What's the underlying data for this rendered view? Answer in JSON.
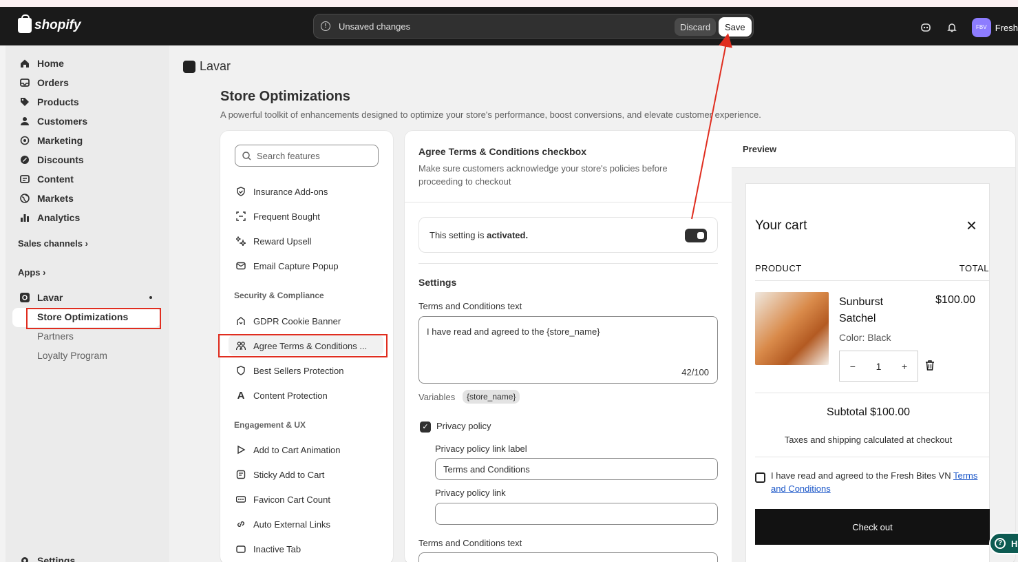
{
  "topbar": {
    "brand": "shopify",
    "unsaved_message": "Unsaved changes",
    "discard_label": "Discard",
    "save_label": "Save",
    "avatar_initials": "FBV",
    "avatar_name": "Fresh"
  },
  "sidebar": {
    "items": [
      {
        "label": "Home",
        "icon": "home-icon"
      },
      {
        "label": "Orders",
        "icon": "inbox-icon"
      },
      {
        "label": "Products",
        "icon": "tag-icon"
      },
      {
        "label": "Customers",
        "icon": "person-icon"
      },
      {
        "label": "Marketing",
        "icon": "target-icon"
      },
      {
        "label": "Discounts",
        "icon": "discount-icon"
      },
      {
        "label": "Content",
        "icon": "content-icon"
      },
      {
        "label": "Markets",
        "icon": "globe-icon"
      },
      {
        "label": "Analytics",
        "icon": "bar-chart-icon"
      }
    ],
    "sales_channels": "Sales channels",
    "apps": "Apps",
    "app_name": "Lavar",
    "app_sub": [
      "Store Optimizations",
      "Partners",
      "Loyalty Program"
    ],
    "settings": "Settings"
  },
  "main": {
    "app_title": "Lavar",
    "page_title": "Store Optimizations",
    "page_subtitle": "A powerful toolkit of enhancements designed to optimize your store's performance, boost conversions, and elevate customer experience."
  },
  "features": {
    "search_placeholder": "Search features",
    "group1": [
      "Insurance Add-ons",
      "Frequent Bought",
      "Reward Upsell",
      "Email Capture Popup"
    ],
    "group2_title": "Security & Compliance",
    "group2": [
      "GDPR Cookie Banner",
      "Agree Terms & Conditions ...",
      "Best Sellers Protection",
      "Content Protection"
    ],
    "group3_title": "Engagement & UX",
    "group3": [
      "Add to Cart Animation",
      "Sticky Add to Cart",
      "Favicon Cart Count",
      "Auto External Links",
      "Inactive Tab"
    ]
  },
  "settings": {
    "title": "Agree Terms & Conditions checkbox",
    "description": "Make sure customers acknowledge your store's policies before proceeding to checkout",
    "status_prefix": "This setting is ",
    "status_value": "activated.",
    "section_title": "Settings",
    "terms_label": "Terms and Conditions text",
    "terms_value": "I have read and agreed to the {store_name}",
    "terms_count": "42/100",
    "variables_label": "Variables",
    "variable_tag": "{store_name}",
    "privacy_label": "Privacy policy",
    "privacy_link_label_label": "Privacy policy link label",
    "privacy_link_label_value": "Terms and Conditions",
    "privacy_link_label2": "Privacy policy link",
    "privacy_link_value": "",
    "terms_label2": "Terms and Conditions text"
  },
  "preview": {
    "title": "Preview",
    "cart_title": "Your cart",
    "col_product": "PRODUCT",
    "col_total": "TOTAL",
    "product_name": "Sunburst Satchel",
    "product_price": "$100.00",
    "product_variant": "Color: Black",
    "quantity": "1",
    "subtotal": "Subtotal $100.00",
    "taxes": "Taxes and shipping calculated at checkout",
    "agree_text": "I have read and agreed to the Fresh Bites VN ",
    "agree_link": "Terms and Conditions",
    "checkout": "Check out"
  },
  "help_label": "H",
  "colors": {
    "annotation": "#e02d1f",
    "topbar": "#1a1a1a",
    "checkout": "#121212"
  }
}
